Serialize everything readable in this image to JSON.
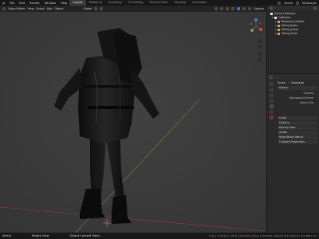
{
  "topbar": {
    "menus": [
      "File",
      "Edit",
      "Render",
      "Window",
      "Help"
    ],
    "tabs": [
      "Layout",
      "Modeling",
      "Sculpting",
      "UV Editing",
      "Texture Paint",
      "Shading",
      "Animation"
    ],
    "active_tab": 0,
    "scene": "Scene",
    "view_layer": "ViewLayer"
  },
  "header": {
    "mode": "Object Mode",
    "items": [
      "View",
      "Select",
      "Add",
      "Object"
    ],
    "shading": "Global",
    "options": "Options"
  },
  "outliner": {
    "title": "Scene Collection",
    "collection": "Collection",
    "objects": [
      "Backpack_Leather",
      "Hiking_Boots",
      "Hiking_Jacket",
      "Hiking_Pants"
    ]
  },
  "properties": {
    "scene_label": "Scene",
    "view_layer": "ViewLayer",
    "section_scene": "Scene",
    "camera_label": "Camera",
    "bg_scene_label": "Background Scene",
    "active_clip_label": "Active Clip",
    "units": "Units",
    "gravity": "Gravity",
    "keying_sets": "Keying Sets",
    "audio": "Audio",
    "rigid_body": "Rigid Body World",
    "custom_props": "Custom Properties"
  },
  "status": {
    "left": "Select",
    "middle": "Rotate View",
    "right": "Object Context Menu",
    "info": "Scene Collection | Verts 1,024,876 | Faces 1,003,500 | Objects 0/4 | Memory 412 MiB | 3.0"
  },
  "colors": {
    "accent": "#4772b3",
    "object_orange": "#e0a04a",
    "axis_red": "#b23a3a",
    "axis_green": "#6a8a3a"
  }
}
